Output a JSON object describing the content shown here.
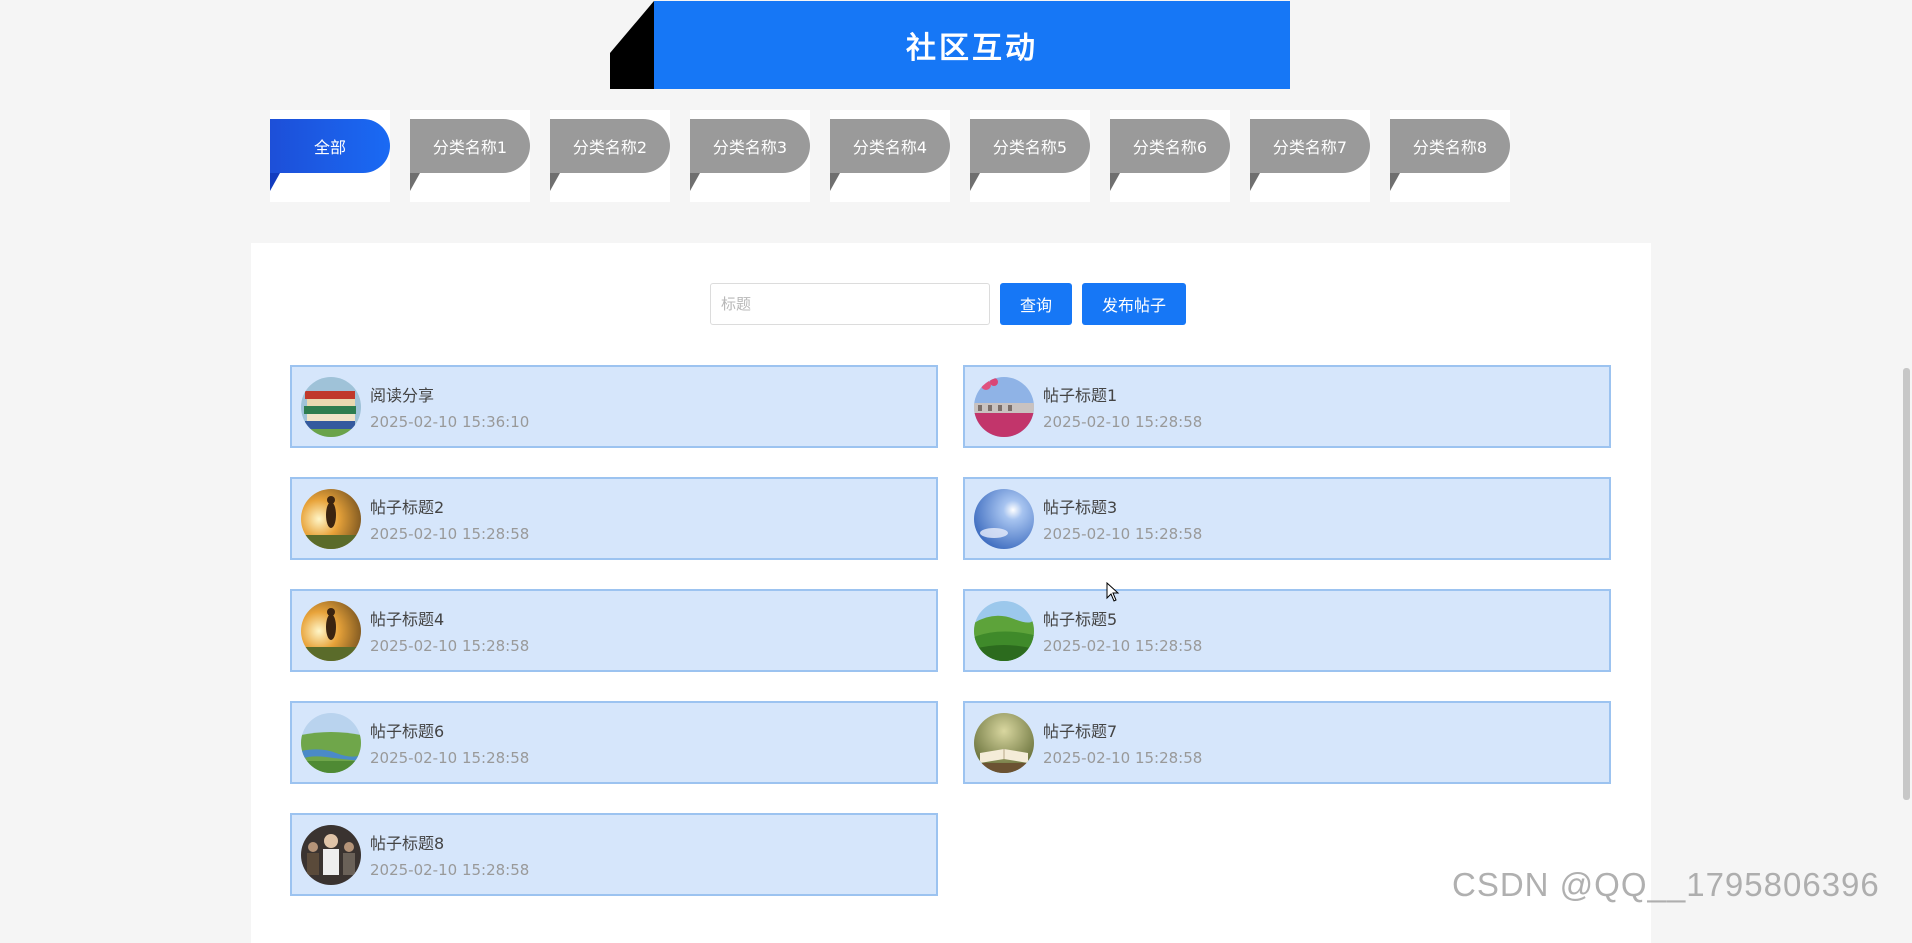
{
  "header": {
    "title": "社区互动"
  },
  "tabs": [
    {
      "label": "全部",
      "active": true
    },
    {
      "label": "分类名称1",
      "active": false
    },
    {
      "label": "分类名称2",
      "active": false
    },
    {
      "label": "分类名称3",
      "active": false
    },
    {
      "label": "分类名称4",
      "active": false
    },
    {
      "label": "分类名称5",
      "active": false
    },
    {
      "label": "分类名称6",
      "active": false
    },
    {
      "label": "分类名称7",
      "active": false
    },
    {
      "label": "分类名称8",
      "active": false
    }
  ],
  "search": {
    "placeholder": "标题",
    "value": "",
    "query_label": "查询",
    "publish_label": "发布帖子"
  },
  "posts": [
    {
      "title": "阅读分享",
      "time": "2025-02-10 15:36:10",
      "thumb": "books-thumbnail"
    },
    {
      "title": "帖子标题1",
      "time": "2025-02-10 15:28:58",
      "thumb": "flowers-building-thumbnail"
    },
    {
      "title": "帖子标题2",
      "time": "2025-02-10 15:28:58",
      "thumb": "runner-sunset-thumbnail"
    },
    {
      "title": "帖子标题3",
      "time": "2025-02-10 15:28:58",
      "thumb": "blue-sky-sun-thumbnail"
    },
    {
      "title": "帖子标题4",
      "time": "2025-02-10 15:28:58",
      "thumb": "runner-sunset-thumbnail"
    },
    {
      "title": "帖子标题5",
      "time": "2025-02-10 15:28:58",
      "thumb": "green-hills-thumbnail"
    },
    {
      "title": "帖子标题6",
      "time": "2025-02-10 15:28:58",
      "thumb": "river-landscape-thumbnail"
    },
    {
      "title": "帖子标题7",
      "time": "2025-02-10 15:28:58",
      "thumb": "open-book-thumbnail"
    },
    {
      "title": "帖子标题8",
      "time": "2025-02-10 15:28:58",
      "thumb": "people-thumbnail"
    }
  ],
  "watermark": "CSDN @QQ__1795806396",
  "colors": {
    "accent": "#1677f6",
    "tab_inactive": "#9a9a9a",
    "card_bg": "#d6e6fb",
    "card_border": "#9cc3f0"
  }
}
